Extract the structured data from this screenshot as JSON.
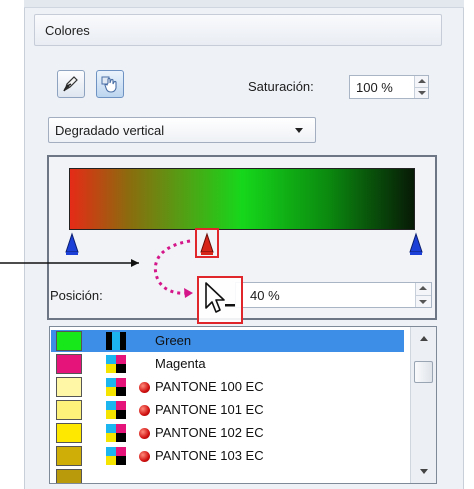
{
  "panel": {
    "section_title": "Colores",
    "tools": [
      {
        "icon": "pencil-pick-icon"
      },
      {
        "icon": "color-hand-icon"
      }
    ],
    "saturation": {
      "label": "Saturación:",
      "value": "100 %"
    },
    "gradient_type": {
      "selected": "Degradado vertical"
    },
    "gradient": {
      "colors": [
        "#e52b16",
        "#8c6b0e",
        "#16d71b",
        "#0b8a0f",
        "#071a06"
      ],
      "stops": [
        {
          "position": 0,
          "color": "#1c3fd8"
        },
        {
          "position": 40,
          "color": "#d62418",
          "selected": true
        },
        {
          "position": 100,
          "color": "#1c3fd8"
        }
      ]
    },
    "position": {
      "label": "Posición:",
      "value": "40 %"
    },
    "color_list": {
      "items": [
        {
          "label": "Green",
          "swatch": "#16e81a",
          "spot": false,
          "selected": true
        },
        {
          "label": "Magenta",
          "swatch": "#e5147a",
          "spot": false,
          "selected": false
        },
        {
          "label": "PANTONE 100 EC",
          "swatch": "#fff7a6",
          "spot": true,
          "selected": false
        },
        {
          "label": "PANTONE 101 EC",
          "swatch": "#fff27a",
          "spot": true,
          "selected": false
        },
        {
          "label": "PANTONE 102 EC",
          "swatch": "#ffe800",
          "spot": true,
          "selected": false
        },
        {
          "label": "PANTONE 103 EC",
          "swatch": "#cfae08",
          "spot": true,
          "selected": false
        }
      ]
    }
  },
  "colors": {
    "highlight": "#e0262a",
    "annotation": "#d4168a",
    "selection": "#3d8ee6"
  }
}
